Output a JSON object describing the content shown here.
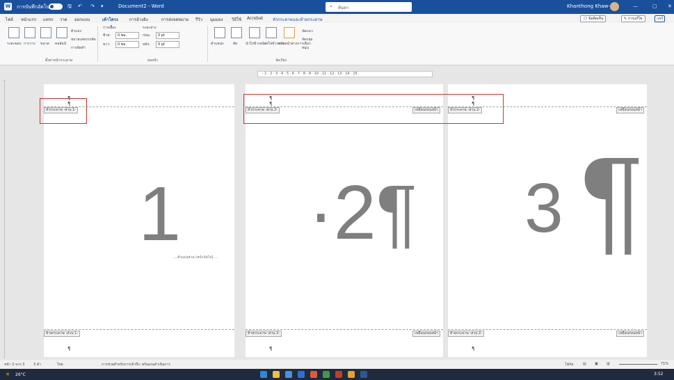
{
  "window": {
    "autosave_label": "การบันทึกอัตโนมัติ",
    "doc_title": "Document2 - Word",
    "search_placeholder": "ค้นหา",
    "user_name": "Khanthong Khaw-on",
    "minimize": "—",
    "restore": "▢",
    "close": "✕"
  },
  "tabs": [
    "ไฟล์",
    "หน้าแรก",
    "แทรก",
    "วาด",
    "ออกแบบ",
    "เค้าโครง",
    "การอ้างอิง",
    "การส่งจดหมาย",
    "รีวิว",
    "มุมมอง",
    "วิธีใช้",
    "Acrobat",
    "หัวกระดาษและท้ายกระดาษ"
  ],
  "ribbon": {
    "comment": "ข้อคิดเห็น",
    "editing": "การแก้ไข",
    "share": "แชร์",
    "margins": "ระยะขอบ",
    "orientation": "การวาง",
    "size": "ขนาด",
    "columns": "คอลัมน์",
    "breaks": "ตัวแบ่ง",
    "line_numbers": "หมายเลขบรรทัด",
    "hyphenation": "การตัดคำ",
    "page_setup_group": "ตั้งค่าหน้ากระดาษ",
    "indent_label": "การเยื้อง",
    "spacing_label": "ระยะห่าง",
    "indent_left_label": "ซ้าย:",
    "indent_left": "0 ซม.",
    "indent_right_label": "ขวา:",
    "indent_right": "0 ซม.",
    "spacing_before_label": "ก่อน:",
    "spacing_before": "0 pt",
    "spacing_after_label": "หลัง:",
    "spacing_after": "0 pt",
    "paragraph_group": "ย่อหน้า",
    "position": "ตำแหน่ง",
    "wrap": "ตัด",
    "bring_forward": "นำไปข้างหน้า",
    "send_backward": "ส่งไปข้างหลัง",
    "selection_pane": "บานหน้าต่างการเลือก",
    "align": "จัดแนว",
    "group": "จัดกลุ่ม",
    "rotate": "หมุน",
    "arrange_group": "จัดเรียง"
  },
  "pages": [
    {
      "header_tag": "หัวกระดาษ -ส่วน 1-",
      "footer_tag": "ท้ายกระดาษ -ส่วน 1-",
      "same_as_prev": "",
      "number": "1",
      "section_break": "....ตัวแบ่งส่วน (หน้าถัดไป)....",
      "pilcrow": "¶"
    },
    {
      "header_tag": "หัวกระดาษ -ส่วน 2-",
      "footer_tag": "ท้ายกระดาษ -ส่วน 2-",
      "same_as_prev": "เหมือนก่อนหน้า",
      "number": "·2¶",
      "section_break": "",
      "pilcrow": "¶"
    },
    {
      "header_tag": "หัวกระดาษ -ส่วน 2-",
      "footer_tag": "ท้ายกระดาษ -ส่วน 2-",
      "same_as_prev": "เหมือนก่อนหน้า",
      "number": "3",
      "big_pilcrow": "¶",
      "pilcrow": "¶"
    }
  ],
  "ruler_text": "· 1 · 2 · 3 · 4 · 5 · 6 · 7 · 8 · 9 · 10 · 11 · 12 · 13 · 14 · 15 ·",
  "status": {
    "page_info": "หน้า 2 จาก 3",
    "words": "3 คำ",
    "lang": "ไทย",
    "accessibility": "การช่วยสำหรับการเข้าถึง: พร้อมรอดำเนินการ",
    "focus": "โฟกัส",
    "zoom": "71%"
  },
  "taskbar": {
    "weather": "26°C",
    "time": "3:52"
  },
  "colors": {
    "title_bar": "#1a4f9c",
    "accent": "#1a4f9c",
    "highlight": "#d32f2f"
  }
}
